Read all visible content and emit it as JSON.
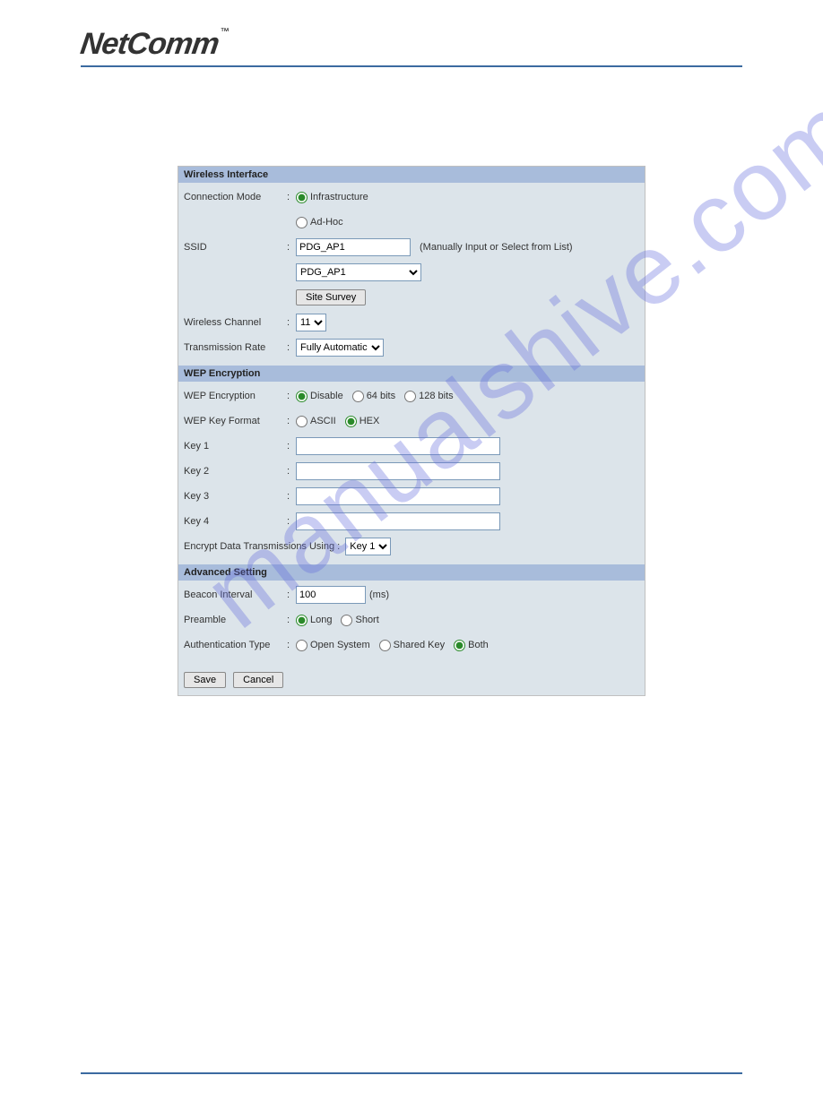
{
  "brand": {
    "name": "NetComm",
    "tm": "™"
  },
  "watermark": "manualshive.com",
  "wireless_interface": {
    "header": "Wireless Interface",
    "connection_mode": {
      "label": "Connection Mode",
      "options": [
        "Infrastructure",
        "Ad-Hoc"
      ],
      "selected": "Infrastructure"
    },
    "ssid": {
      "label": "SSID",
      "value": "PDG_AP1",
      "hint": "(Manually Input or Select from List)",
      "dropdown_value": "PDG_AP1",
      "site_survey_btn": "Site Survey"
    },
    "wireless_channel": {
      "label": "Wireless Channel",
      "value": "11"
    },
    "transmission_rate": {
      "label": "Transmission Rate",
      "value": "Fully Automatic"
    }
  },
  "wep": {
    "header": "WEP Encryption",
    "encryption": {
      "label": "WEP Encryption",
      "options": [
        "Disable",
        "64 bits",
        "128 bits"
      ],
      "selected": "Disable"
    },
    "key_format": {
      "label": "WEP Key Format",
      "options": [
        "ASCII",
        "HEX"
      ],
      "selected": "HEX"
    },
    "key1": {
      "label": "Key 1",
      "value": ""
    },
    "key2": {
      "label": "Key 2",
      "value": ""
    },
    "key3": {
      "label": "Key 3",
      "value": ""
    },
    "key4": {
      "label": "Key 4",
      "value": ""
    },
    "encrypt_using": {
      "label": "Encrypt Data Transmissions Using :",
      "value": "Key 1"
    }
  },
  "advanced": {
    "header": "Advanced Setting",
    "beacon_interval": {
      "label": "Beacon Interval",
      "value": "100",
      "unit": "(ms)"
    },
    "preamble": {
      "label": "Preamble",
      "options": [
        "Long",
        "Short"
      ],
      "selected": "Long"
    },
    "auth_type": {
      "label": "Authentication Type",
      "options": [
        "Open System",
        "Shared Key",
        "Both"
      ],
      "selected": "Both"
    }
  },
  "buttons": {
    "save": "Save",
    "cancel": "Cancel"
  }
}
